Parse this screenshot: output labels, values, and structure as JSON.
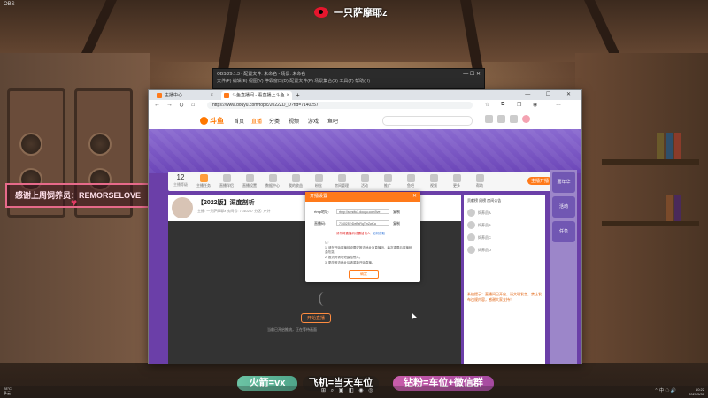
{
  "overlay": {
    "topline": "OBS",
    "streamer_name": "一只萨摩耶z",
    "thanks_text": "感谢上周饲养员：REMORSELOVE",
    "badges": [
      "火箭=vx",
      "飞机=当天车位",
      "钻粉=车位+微信群"
    ]
  },
  "obs": {
    "title": "OBS 29.1.3 - 配置文件: 未命名 - 场景: 未命名",
    "menu": "文件(F)  编辑(E)  视图(V)  停靠窗口(D)  配置文件(P)  场景集合(S)  工具(T)  帮助(H)",
    "controls": "—  ☐  ✕"
  },
  "browser": {
    "tabs": [
      {
        "label": "主播中心",
        "active": false,
        "color": "#ff7a1a"
      },
      {
        "label": "斗鱼直播间 - 看直播上斗鱼",
        "active": true,
        "color": "#ff7a1a"
      }
    ],
    "new_tab": "+",
    "window_controls": "— ☐ ✕",
    "url": "https://www.douyu.com/topic/2022ZD_D?rid=7140257"
  },
  "site": {
    "logo": "斗鱼",
    "nav": [
      "首页",
      "直播",
      "分类",
      "视频",
      "游戏",
      "鱼吧"
    ],
    "nav_selected": 1,
    "level": "12",
    "level_sub": "主播等级",
    "nav_items": [
      "主播任务",
      "直播伴侣",
      "直播设置",
      "数据中心",
      "我的收益",
      "粉丝",
      "房间管理",
      "活动",
      "推广",
      "鱼吧",
      "视频",
      "更多",
      "帮助"
    ],
    "action_button": "主播开播",
    "room_title": "【2022版】深度剖析",
    "room_meta": "主播: 一只萨摩耶z  房间号: 7140257  分区: 户外",
    "sidebar_header": "贡献榜  周榜  房间公告",
    "rank_names": [
      "饲养员A",
      "饲养员B",
      "饲养员C",
      "饲养员D"
    ],
    "sidebar_message": "系统提示：直播间已开启，请文明发言，禁止发布违规内容，感谢大家支持！",
    "player_button": "开始直播",
    "player_note": "当前已开启推流，正在等待画面",
    "right_ads": [
      "嘉年华",
      "活动",
      "任务"
    ]
  },
  "dialog": {
    "title": "开播设置",
    "close": "✕",
    "rtmp_label": "rtmp地址:",
    "rtmp_value": "rtmp://sendtc3.douyu.com/live",
    "stream_label": "直播码:",
    "stream_value": "7140257rDeBxRqTmZwKa",
    "copy": "复制",
    "warning": "请勿将直播码泄露给他人",
    "learn_more": "如何获取",
    "notes": [
      "注:",
      "1. 请在开始直播前设置好推流地址及直播码，每次重置后直播码会改变。",
      "2. 推流码请勿泄露给他人。",
      "3. 更改推流地址后请重新开始直播。"
    ],
    "ok": "确定"
  },
  "taskbar": {
    "left": "28°C\n多云",
    "center": "⊞ ⌕ ▣ ◧ ◉ ◎",
    "right": "⌃ 中 ☁ 🔊",
    "time": "10:22\n2023/5/30"
  }
}
